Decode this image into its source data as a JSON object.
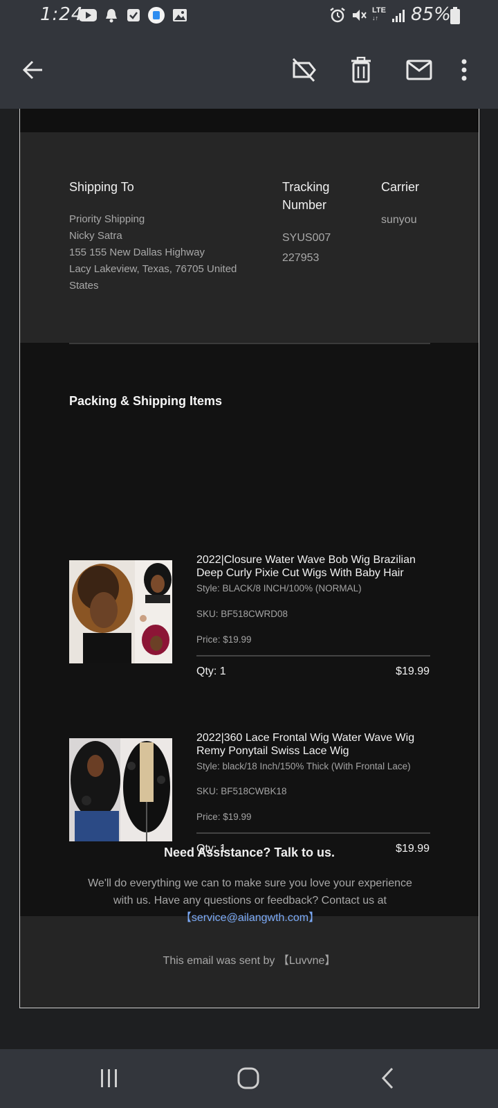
{
  "status_bar": {
    "time": "1:24",
    "battery": "85%",
    "network": "LTE",
    "left_icons": [
      "youtube-icon",
      "bell-icon",
      "checkbox-icon",
      "security-icon",
      "image-icon"
    ],
    "right_icons": [
      "alarm-icon",
      "mute-icon",
      "lte-icon",
      "signal-icon",
      "battery-icon"
    ]
  },
  "toolbar": {
    "back_icon": "arrow-left-icon",
    "actions": [
      "label-off-icon",
      "delete-icon",
      "mail-icon",
      "more-vert-icon"
    ]
  },
  "shipping": {
    "ship_to_title": "Shipping To",
    "ship_to_lines": [
      "Priority Shipping",
      "Nicky Satra",
      "155 155 New Dallas Highway",
      "Lacy Lakeview, Texas, 76705 United",
      "States"
    ],
    "tracking_title_1": "Tracking",
    "tracking_title_2": "Number",
    "tracking_lines": [
      "SYUS007",
      "227953"
    ],
    "carrier_title": "Carrier",
    "carrier": "sunyou"
  },
  "items_section": {
    "title": "Packing & Shipping Items",
    "items": [
      {
        "name_1": "2022|Closure Water Wave Bob Wig Brazilian",
        "name_2": "Deep Curly Pixie Cut Wigs With Baby Hair",
        "style": "Style: BLACK/8 INCH/100% (NORMAL)",
        "sku": "SKU: BF518CWRD08",
        "price": "Price: $19.99",
        "qty": "Qty: 1",
        "total": "$19.99"
      },
      {
        "name_1": "2022|360 Lace Frontal Wig Water Wave Wig",
        "name_2": "Remy Ponytail Swiss Lace Wig",
        "style": "Style: black/18 Inch/150% Thick (With Frontal Lace)",
        "sku": "SKU: BF518CWBK18",
        "price": "Price: $19.99",
        "qty": "Qty: 1",
        "total": "$19.99"
      }
    ]
  },
  "help": {
    "title": "Need Assistance? Talk to us.",
    "line_1": "We'll do everything we can to make sure you love your experience",
    "line_2": "with us. Have any questions or feedback? Contact us at",
    "email": "【service@ailangwth.com】",
    "sent_by": "This email was sent by 【Luvvne】"
  },
  "colors": {
    "link": "#7baaf7",
    "bar": "#33363c",
    "panel": "#262626",
    "body": "#121212"
  },
  "nav_bar": {
    "icons": [
      "recent-apps-icon",
      "home-icon",
      "back-icon"
    ]
  }
}
